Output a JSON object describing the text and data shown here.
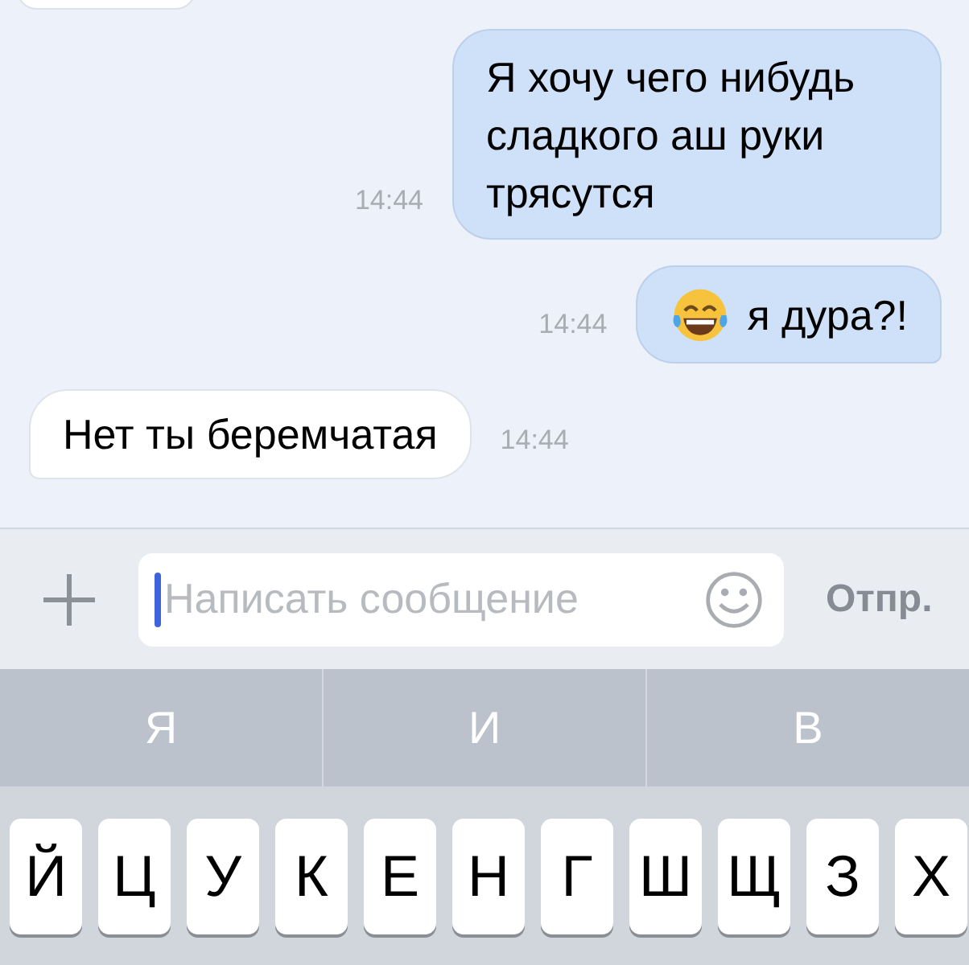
{
  "messages": [
    {
      "kind": "text",
      "text": "Я хочу чего нибудь сладкого аш руки трясутся",
      "time": "14:44",
      "outgoing": true
    },
    {
      "kind": "emoji-text",
      "text": "я дура?!",
      "time": "14:44",
      "outgoing": true
    },
    {
      "kind": "text",
      "text": "Нет ты беремчатая",
      "time": "14:44",
      "outgoing": false
    }
  ],
  "composer": {
    "placeholder": "Написать сообщение",
    "focused": true,
    "send_label": "Отпр."
  },
  "suggestions": [
    "Я",
    "И",
    "В"
  ],
  "keys": [
    "Й",
    "Ц",
    "У",
    "К",
    "Е",
    "Н",
    "Г",
    "Ш",
    "Щ",
    "З",
    "Х"
  ]
}
